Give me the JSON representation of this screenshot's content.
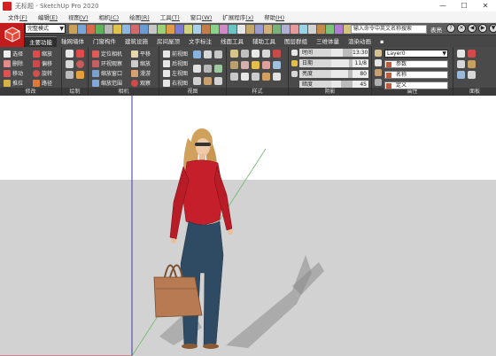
{
  "window": {
    "title": "无标题 - SketchUp Pro 2020",
    "minimize_glyph": "—",
    "maximize_glyph": "☐",
    "close_glyph": "✕"
  },
  "menu": [
    {
      "label": "文件",
      "key": "(F)"
    },
    {
      "label": "编辑",
      "key": "(E)"
    },
    {
      "label": "视图",
      "key": "(V)"
    },
    {
      "label": "相机",
      "key": "(C)"
    },
    {
      "label": "绘图",
      "key": "(R)"
    },
    {
      "label": "工具",
      "key": "(T)"
    },
    {
      "label": "窗口",
      "key": "(W)"
    },
    {
      "label": "扩展程序",
      "key": "(x)"
    },
    {
      "label": "帮助",
      "key": "(H)"
    }
  ],
  "topbar": {
    "style_mode": "完整模式",
    "command_placeholder": "输入命令中英文名称搜索",
    "user": "表亮",
    "round_buttons": [
      "?",
      "✕",
      "◀",
      "▶",
      "▼"
    ]
  },
  "tabs": [
    "主要功能",
    "轴网墙体",
    "门窗构件",
    "建筑设施",
    "房间屋顶",
    "文字标注",
    "线面工具",
    "辅助工具",
    "图层群组",
    "三维体量",
    "渲染动画",
    "▪"
  ],
  "ribbon": {
    "edit": {
      "label": "修改",
      "buttons": [
        "选择",
        "删除",
        "移动",
        "推拉",
        "缩放",
        "偏移",
        "旋转",
        "路径"
      ]
    },
    "draw": {
      "label": "绘制"
    },
    "camera": {
      "label": "相机",
      "buttons": [
        "定位相机",
        "环视观察",
        "缩放窗口",
        "缩放范围",
        "平移",
        "缩放",
        "漫游",
        "观察"
      ]
    },
    "views": {
      "label": "视图",
      "buttons": [
        "前视图",
        "后视图",
        "左视图",
        "右视图"
      ]
    },
    "styles": {
      "label": "样式"
    },
    "shadow": {
      "label": "阴影",
      "sliders": [
        {
          "label": "时间",
          "value": "13:30",
          "level": 0.55
        },
        {
          "label": "日期",
          "value": "11/8",
          "level": 0.85
        },
        {
          "label": "亮度",
          "value": "80",
          "level": 0.8
        },
        {
          "label": "暗度",
          "value": "45",
          "level": 0.45
        }
      ]
    },
    "attributes": {
      "label": "属性",
      "layer": "Layer0",
      "fields": [
        "参数",
        "名称",
        "定义"
      ]
    },
    "panel": {
      "label": "面板"
    }
  },
  "colors": {
    "logo_red": "#c31c1c",
    "ribbon_bg": "#4a4a4a",
    "sky": "#ffffff",
    "ground": "#d2d2d2",
    "jacket": "#c41f2b",
    "jeans": "#2f4a63",
    "bag": "#b87a52",
    "hair": "#d0a15d"
  }
}
